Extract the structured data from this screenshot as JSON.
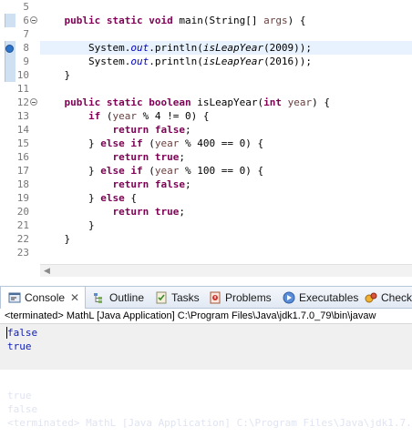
{
  "editor": {
    "lines": [
      {
        "num": "5",
        "code": ""
      },
      {
        "num": "6",
        "code": "    public static void main(String[] args) {"
      },
      {
        "num": "7",
        "code": ""
      },
      {
        "num": "8",
        "code": "        System.out.println(isLeapYear(2009));"
      },
      {
        "num": "9",
        "code": "        System.out.println(isLeapYear(2016));"
      },
      {
        "num": "10",
        "code": "    }"
      },
      {
        "num": "11",
        "code": ""
      },
      {
        "num": "12",
        "code": "    public static boolean isLeapYear(int year) {"
      },
      {
        "num": "13",
        "code": "        if (year % 4 != 0) {"
      },
      {
        "num": "14",
        "code": "            return false;"
      },
      {
        "num": "15",
        "code": "        } else if (year % 400 == 0) {"
      },
      {
        "num": "16",
        "code": "            return true;"
      },
      {
        "num": "17",
        "code": "        } else if (year % 100 == 0) {"
      },
      {
        "num": "18",
        "code": "            return false;"
      },
      {
        "num": "19",
        "code": "        } else {"
      },
      {
        "num": "20",
        "code": "            return true;"
      },
      {
        "num": "21",
        "code": "        }"
      },
      {
        "num": "22",
        "code": "    }"
      },
      {
        "num": "23",
        "code": ""
      }
    ]
  },
  "views": {
    "tabs": [
      {
        "label": "Console",
        "icon": "console-icon",
        "active": true
      },
      {
        "label": "Outline",
        "icon": "outline-icon"
      },
      {
        "label": "Tasks",
        "icon": "tasks-icon"
      },
      {
        "label": "Problems",
        "icon": "problems-icon"
      },
      {
        "label": "Executables",
        "icon": "executables-icon"
      },
      {
        "label": "Check",
        "icon": "check-icon"
      }
    ],
    "close_glyph": "✕"
  },
  "console": {
    "status": "<terminated> MathL [Java Application] C:\\Program Files\\Java\\jdk1.7.0_79\\bin\\javaw",
    "output": [
      "false",
      "true"
    ]
  },
  "colors": {
    "keyword": "#7f0055",
    "field": "#0000c0",
    "output": "#1020b8",
    "current_line": "#e8f2fe"
  }
}
